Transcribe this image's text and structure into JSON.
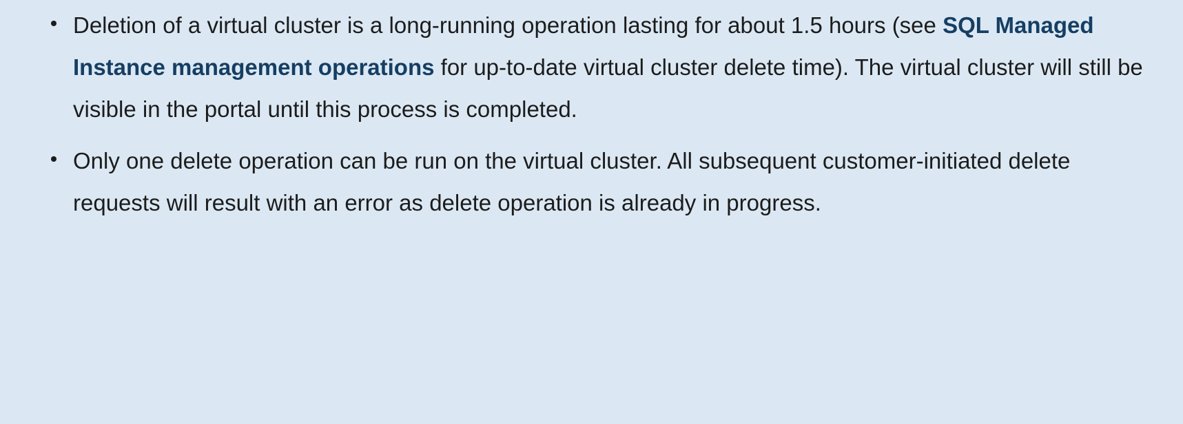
{
  "bullets": [
    {
      "pre": "Deletion of a virtual cluster is a long-running operation lasting for about 1.5 hours (see ",
      "link": "SQL Managed Instance management operations",
      "post": " for up-to-date virtual cluster delete time). The virtual cluster will still be visible in the portal until this process is completed."
    },
    {
      "text": "Only one delete operation can be run on the virtual cluster. All subsequent customer-initiated delete requests will result with an error as delete operation is already in progress."
    }
  ]
}
